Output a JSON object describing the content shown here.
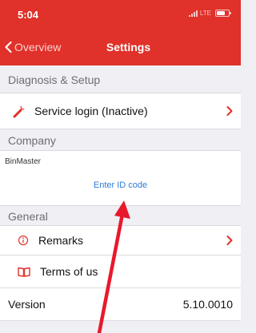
{
  "status_bar": {
    "time": "5:04",
    "network": "LTE"
  },
  "nav": {
    "back_label": "Overview",
    "title": "Settings"
  },
  "sections": {
    "diagnosis": "Diagnosis & Setup",
    "company": "Company",
    "general": "General"
  },
  "service_login": {
    "label": "Service login (Inactive)"
  },
  "company": {
    "name": "BinMaster",
    "enter_id_link": "Enter ID code"
  },
  "remarks": {
    "label": "Remarks"
  },
  "terms": {
    "label": "Terms of us"
  },
  "version": {
    "label": "Version",
    "value": "5.10.0010"
  },
  "colors": {
    "brand_red": "#e0312a",
    "link_blue": "#2f7ad6",
    "chevron_red": "#e0312a"
  },
  "icons": [
    "wrench-icon",
    "info-icon",
    "book-icon",
    "chevron-right-icon",
    "chevron-left-icon"
  ]
}
